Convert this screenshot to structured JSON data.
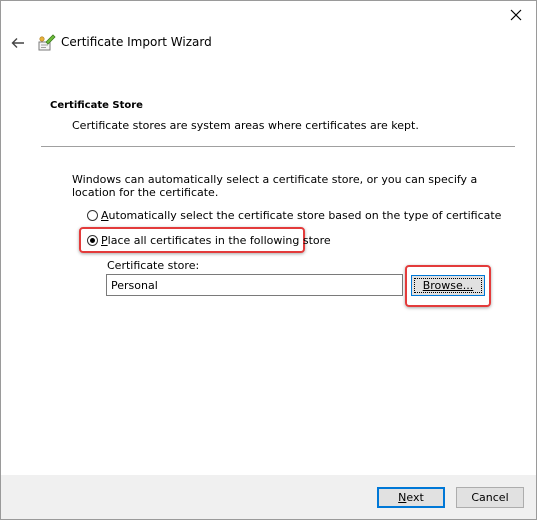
{
  "window": {
    "title": "Certificate Import Wizard",
    "close_icon": "close-icon",
    "back_icon": "back-arrow-icon",
    "wizard_icon": "certificate-wizard-icon"
  },
  "section": {
    "title": "Certificate Store",
    "description": "Certificate stores are system areas where certificates are kept."
  },
  "intro": "Windows can automatically select a certificate store, or you can specify a location for the certificate.",
  "options": {
    "auto": {
      "mnemonic": "A",
      "label_rest": "utomatically select the certificate store based on the type of certificate",
      "checked": false
    },
    "place": {
      "mnemonic": "P",
      "label_rest": "lace all certificates in the following store",
      "checked": true
    }
  },
  "store": {
    "label": "Certificate store:",
    "value": "Personal",
    "browse_mnemonic": "B",
    "browse_rest": "rowse..."
  },
  "footer": {
    "next_mnemonic": "N",
    "next_rest": "ext",
    "cancel_label": "Cancel"
  },
  "colors": {
    "highlight": "#e33b3b",
    "accent": "#0078d7",
    "footer_bg": "#f0f0f0"
  }
}
